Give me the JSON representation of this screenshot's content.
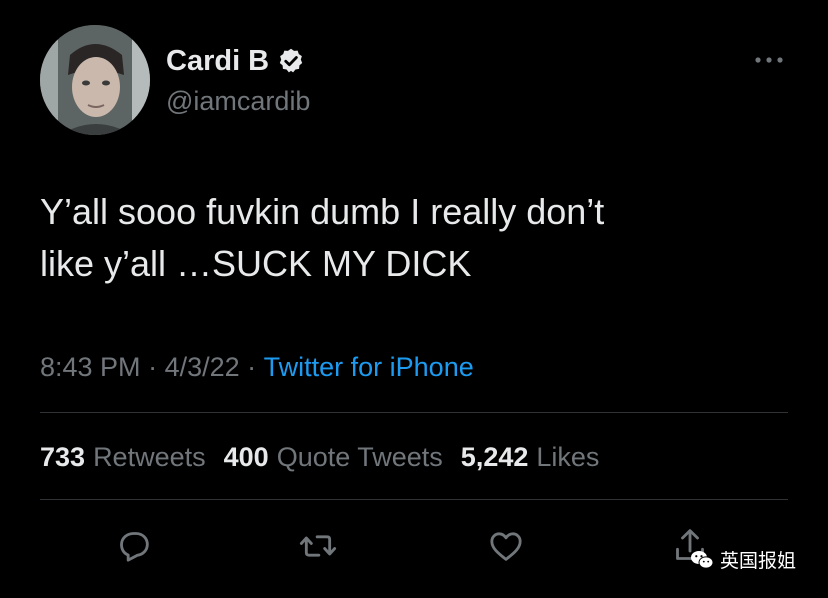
{
  "user": {
    "display_name": "Cardi B",
    "handle": "@iamcardib",
    "verified": true
  },
  "tweet": {
    "text": "Y’all sooo fuvkin dumb I really don’t\nlike y’all …SUCK MY DICK",
    "time": "8:43 PM",
    "separator": " · ",
    "date": "4/3/22",
    "source": "Twitter for iPhone"
  },
  "stats": {
    "retweets_count": "733",
    "retweets_label": "Retweets",
    "quote_count": "400",
    "quote_label": "Quote Tweets",
    "likes_count": "5,242",
    "likes_label": "Likes"
  },
  "actions": {
    "reply": "reply-icon",
    "retweet": "retweet-icon",
    "like": "heart-icon",
    "share": "share-icon"
  },
  "watermark": {
    "text": "英国报姐"
  },
  "colors": {
    "background": "#000000",
    "primary_text": "#e7e9ea",
    "secondary_text": "#71767b",
    "accent": "#1d9bf0",
    "divider": "#2f3336"
  }
}
